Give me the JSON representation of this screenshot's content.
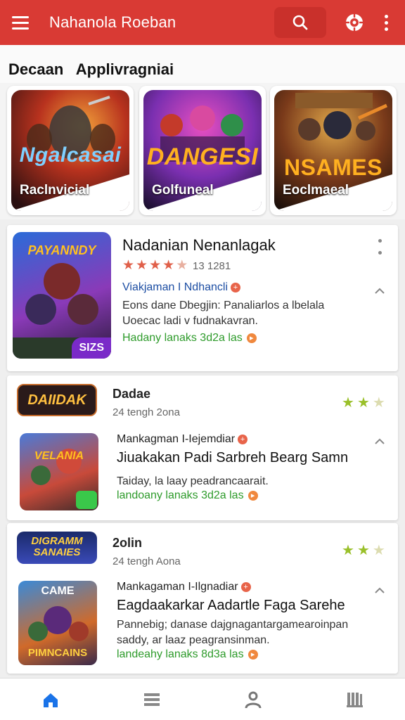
{
  "topbar": {
    "title": "Nahanola Roeban",
    "icons": [
      "menu-icon",
      "search-icon",
      "settings-icon",
      "more-vert-icon"
    ],
    "color": "#d93a34"
  },
  "section": {
    "title": "Decaan   Applivragniai"
  },
  "featured": [
    {
      "logo": "Ngalcasai",
      "label": "Raclnvicial",
      "logo_color": "#7fd0ff"
    },
    {
      "logo": "DANGESI",
      "label": "Golfuneal",
      "logo_color": "#ffb020"
    },
    {
      "logo": "NSAMES",
      "label": "Eoclmaeal",
      "logo_color": "#ffb020"
    }
  ],
  "apps": [
    {
      "title": "Nadanian Nenanlagak",
      "rating_count": "13 1281",
      "stars": 5,
      "developer": "Viakjaman I Ndhancli",
      "desc_line1": "Eons dane Dbegjin: Panaliarlos a lbelala",
      "desc_line2": "Uoecac ladi v fudnakavran.",
      "install": "Hadany lanaks 3d2a las",
      "icon_text": "PAYANNDY",
      "icon_badge": "SIZS"
    },
    {
      "small_icon_text": "DAIIDAK",
      "name": "Dadae",
      "meta": "24 tengh 2ona",
      "rating_stars": 2,
      "developer": "Mankagman I-Iejemdiar",
      "title": "Jiuakakan Padi Sarbreh Bearg Samn",
      "desc": "Taiday, la laay peadrancaarait.",
      "install": "landoany lanaks 3d2a las",
      "icon_text": "VELANIA"
    },
    {
      "small_icon_text": "DIGRAMM SANAIES",
      "name": "2olin",
      "meta": "24 tengh Aona",
      "rating_stars": 2,
      "developer": "Mankagaman I-Ilgnadiar",
      "title": "Eagdaakarkar Aadartle Faga Sarehe",
      "desc_line1": "Pannebig; danase dajgnagantargamearoinpan",
      "desc_line2": "saddy, ar laaz peagransinman.",
      "install": "landeahy lanaks 8d3a las",
      "icon_top": "CAME",
      "icon_text": "PIMNCAINS"
    }
  ],
  "bottom_nav": [
    "home-icon",
    "list-icon",
    "person-icon",
    "library-icon"
  ],
  "colors": {
    "accent": "#d93a34",
    "install": "#2e9b2b",
    "link": "#1d4ea3",
    "nav_active": "#1a73e8"
  }
}
